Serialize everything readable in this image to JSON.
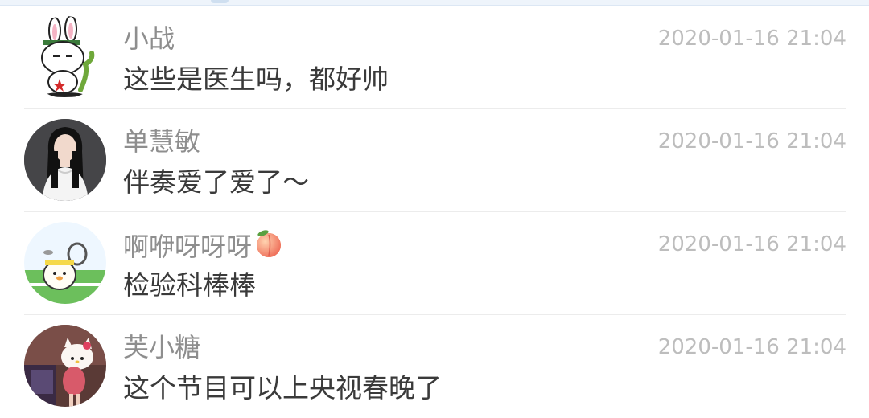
{
  "comments": [
    {
      "name": "小战",
      "time": "2020-01-16 21:04",
      "message": "这些是医生吗，都好帅",
      "avatar_icon": "rabbit-soldier-avatar"
    },
    {
      "name": "单慧敏",
      "time": "2020-01-16 21:04",
      "message": "伴奏爱了爱了～",
      "avatar_icon": "woman-photo-avatar"
    },
    {
      "name": "啊咿呀呀呀",
      "name_emoji": "peach-emoji",
      "time": "2020-01-16 21:04",
      "message": "检验科棒棒",
      "avatar_icon": "cartoon-tennis-avatar"
    },
    {
      "name": "芙小糖",
      "time": "2020-01-16 21:04",
      "message": "这个节目可以上央视春晚了",
      "avatar_icon": "photo-avatar"
    }
  ],
  "colors": {
    "name": "#8e8e8e",
    "time": "#bdbdbd",
    "message": "#3a3a3a",
    "divider": "#ececec",
    "top_strip": "#eef4fb"
  }
}
